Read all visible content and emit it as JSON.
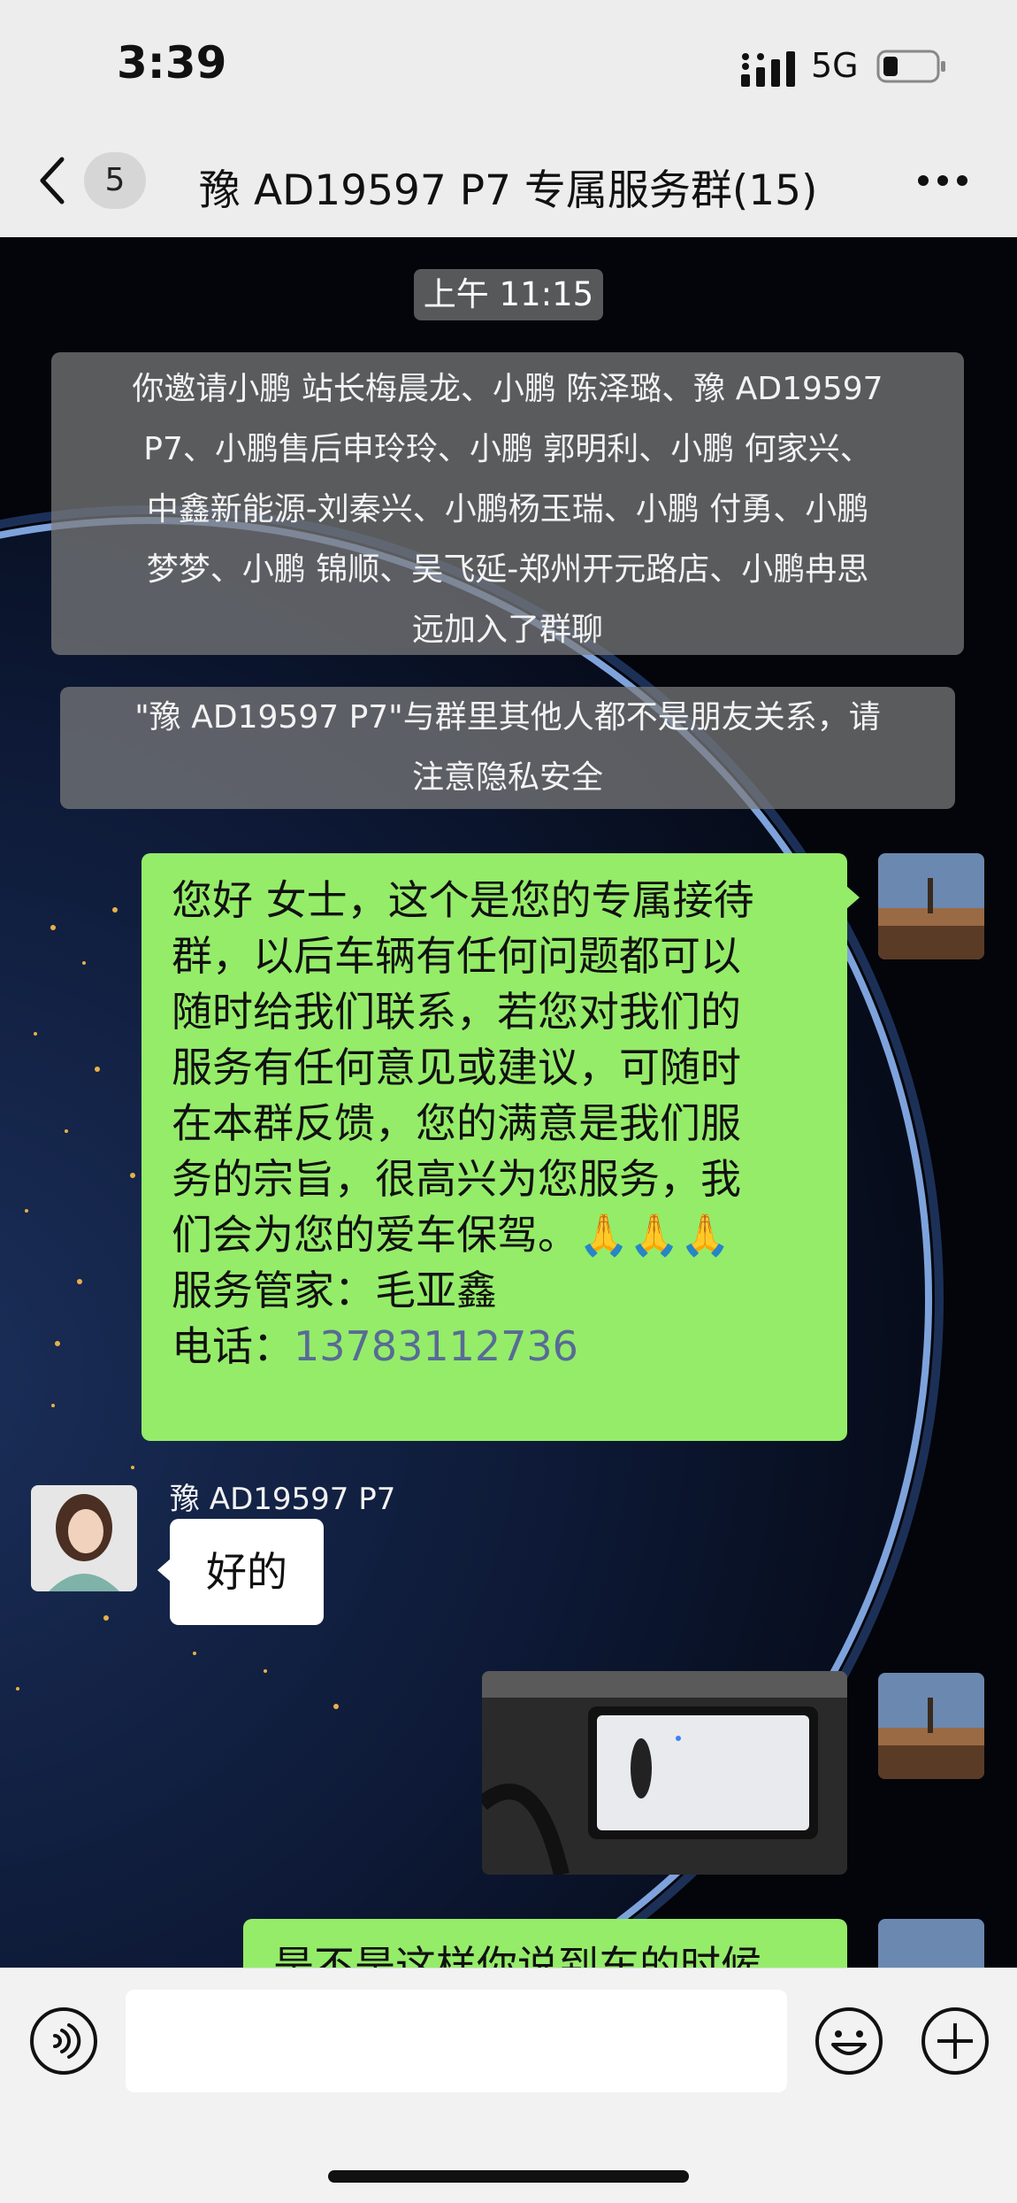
{
  "status_bar": {
    "time": "3:39",
    "network": "5G"
  },
  "nav": {
    "unread_count": "5",
    "title": "豫 AD19597 P7 专属服务群(15)"
  },
  "messages": {
    "timestamp": "上午 11:15",
    "system_invite": [
      "你邀请小鹏 站长梅晨龙、小鹏 陈泽璐、豫 AD19597",
      "P7、小鹏售后申玲玲、小鹏 郭明利、小鹏 何家兴、",
      "中鑫新能源-刘秦兴、小鹏杨玉瑞、小鹏 付勇、小鹏",
      "梦梦、小鹏 锦顺、吴飞延-郑州开元路店、小鹏冉思",
      "远加入了群聊"
    ],
    "system_privacy": [
      "\"豫 AD19597 P7\"与群里其他人都不是朋友关系，请",
      "注意隐私安全"
    ],
    "welcome_lines": [
      "您好 女士，这个是您的专属接待",
      "群，以后车辆有任何问题都可以",
      "随时给我们联系，若您对我们的",
      "服务有任何意见或建议，可随时",
      "在本群反馈，您的满意是我们服",
      "务的宗旨，很高兴为您服务，我",
      "们会为您的爱车保驾。🙏🙏🙏",
      "服务管家：毛亚鑫"
    ],
    "phone_label": "电话：",
    "phone_number": "13783112736",
    "reply_sender": "豫 AD19597 P7",
    "reply_text": "好的",
    "partial_text": "是不是这样你说到车的时候"
  },
  "input": {
    "placeholder": ""
  }
}
